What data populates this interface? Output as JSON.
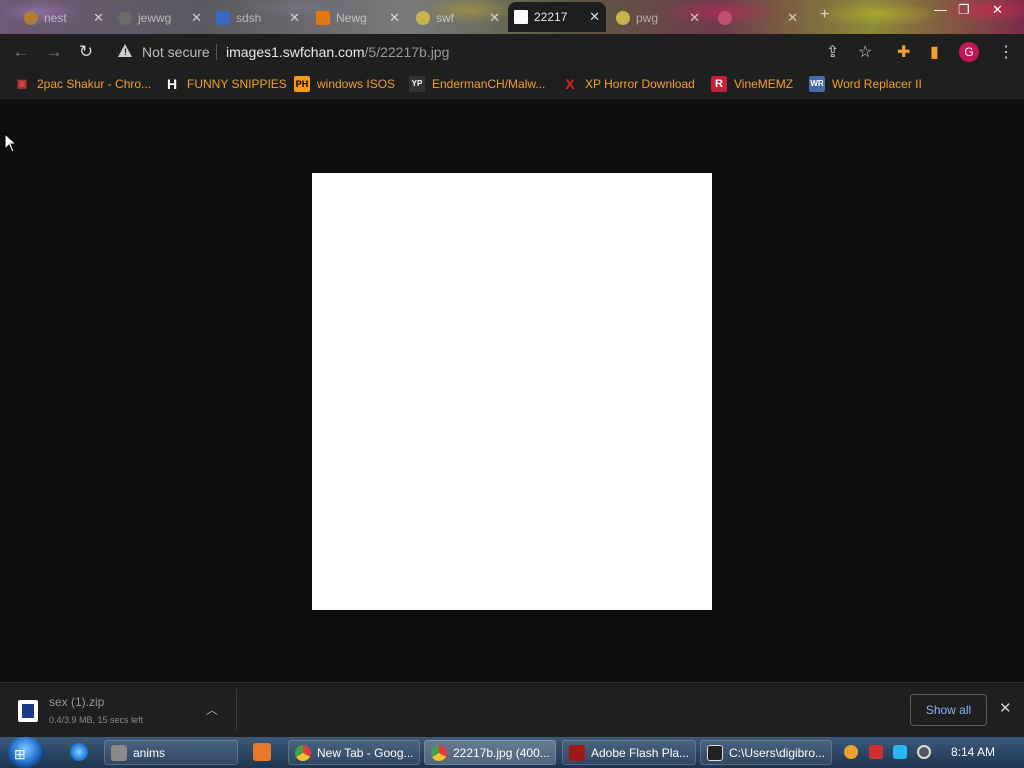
{
  "tabs": [
    {
      "label": "nest",
      "favicon_color": "#b07c3a",
      "active": false
    },
    {
      "label": "jewwg",
      "favicon_color": "#6a6a6a",
      "active": false
    },
    {
      "label": "sdsh",
      "favicon_color": "#3b67c4",
      "active": false
    },
    {
      "label": "Newg",
      "favicon_color": "#e07a14",
      "active": false
    },
    {
      "label": "swf",
      "favicon_color": "#c9b44a",
      "active": false
    },
    {
      "label": "22217",
      "favicon_color": "#ffffff",
      "active": true
    },
    {
      "label": "pwg",
      "favicon_color": "#c9b44a",
      "active": false
    }
  ],
  "toolbar": {
    "security_text": "Not secure",
    "url_host": "images1.swfchan.com",
    "url_path": "/5/22217b.jpg",
    "profile_initial": "G",
    "profile_color": "#c2185b"
  },
  "bookmarks": [
    {
      "label": "2pac Shakur - Chro...",
      "icon": "2pac-icon",
      "glyph": "▣",
      "color": "#d84040"
    },
    {
      "label": "FUNNY SNIPPIES",
      "icon": "h-icon",
      "glyph": "H",
      "color": "#ffffff"
    },
    {
      "label": "windows ISOS",
      "icon": "ph-icon",
      "glyph": "PH",
      "color": "#f7971d"
    },
    {
      "label": "EndermanCH/Malw...",
      "icon": "yp-icon",
      "glyph": "YP",
      "color": "#333333"
    },
    {
      "label": "XP Horror Download",
      "icon": "x-icon",
      "glyph": "X",
      "color": "#e02020"
    },
    {
      "label": "VineMEMZ",
      "icon": "r-icon",
      "glyph": "R",
      "color": "#c4213b"
    },
    {
      "label": "Word Replacer II",
      "icon": "wr-icon",
      "glyph": "WR",
      "color": "#4a6aa8"
    }
  ],
  "download": {
    "filename": "sex (1).zip",
    "status": "0.4/3.9 MB, 15 secs left",
    "show_all_label": "Show all"
  },
  "taskbar": {
    "items": [
      {
        "label": "anims",
        "icon": "folder-icon",
        "color": "#8a8a8a",
        "active": false
      },
      {
        "label": "New Tab - Goog...",
        "icon": "chrome-icon",
        "color": "#4caf50",
        "active": false
      },
      {
        "label": "22217b.jpg (400...",
        "icon": "chrome-icon",
        "color": "#4caf50",
        "active": true
      },
      {
        "label": "Adobe Flash Pla...",
        "icon": "flash-icon",
        "color": "#a01818",
        "active": false
      },
      {
        "label": "C:\\Users\\digibro...",
        "icon": "7zip-icon",
        "color": "#222222",
        "active": false
      }
    ],
    "clock": "8:14 AM"
  }
}
